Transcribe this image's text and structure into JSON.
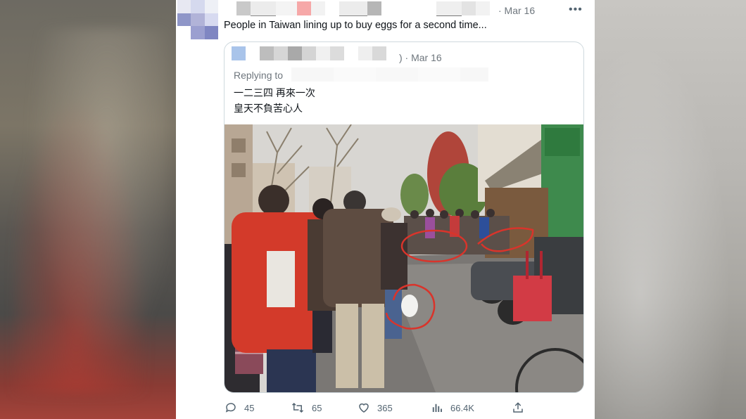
{
  "tweet": {
    "date": "· Mar 16",
    "text": "People in Taiwan lining up to buy eggs for a second time...",
    "more_icon": "more-horizontal-icon"
  },
  "quote": {
    "date": ") · Mar 16",
    "replying_label": "Replying to",
    "lines": [
      "一二三四 再來一次",
      "皇天不負苦心人"
    ],
    "photo_alt": "Queue of people on a street holding bags of eggs, circled in red"
  },
  "actions": {
    "reply": {
      "icon": "reply-icon",
      "count": "45"
    },
    "retweet": {
      "icon": "retweet-icon",
      "count": "65"
    },
    "like": {
      "icon": "heart-icon",
      "count": "365"
    },
    "views": {
      "icon": "views-chart-icon",
      "count": "66.4K"
    },
    "share": {
      "icon": "share-icon"
    }
  },
  "colors": {
    "text_primary": "#0f1419",
    "text_secondary": "#6e767d",
    "border": "#cfd9de",
    "annotation_red": "#d9342b"
  }
}
